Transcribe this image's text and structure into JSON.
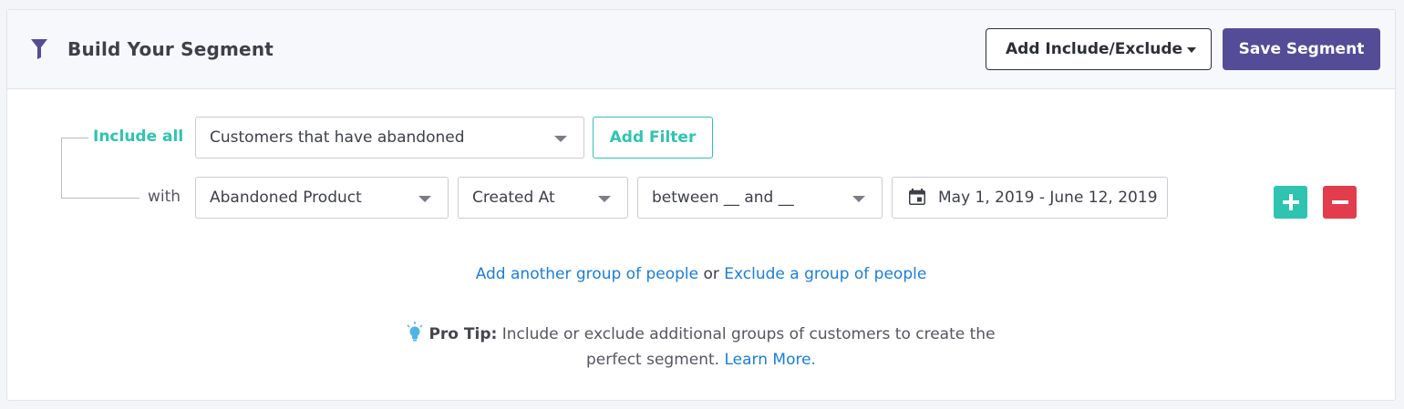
{
  "header": {
    "title": "Build Your Segment",
    "add_include_exclude_label": "Add Include/Exclude",
    "save_segment_label": "Save Segment"
  },
  "group": {
    "include_label": "Include all",
    "audience_select": "Customers that have abandoned",
    "add_filter_label": "Add Filter",
    "with_label": "with",
    "filter": {
      "property_select": "Abandoned Product",
      "field_select": "Created At",
      "operator_select": "between __ and __",
      "date_range": "May 1, 2019 - June 12, 2019"
    }
  },
  "links": {
    "add_group": "Add another group of people",
    "separator": "or",
    "exclude_group": "Exclude a group of people"
  },
  "pro_tip": {
    "label": "Pro Tip:",
    "text_line1": "Include or exclude additional groups of customers to create the",
    "text_line2": "perfect segment.",
    "learn_more": "Learn More."
  },
  "colors": {
    "accent_purple": "#554c98",
    "teal": "#2ec4b0",
    "red": "#e33d4d",
    "link_blue": "#1a7ed9"
  },
  "icons": {
    "filter": "funnel-icon",
    "calendar": "calendar-icon",
    "add": "plus-icon",
    "remove": "minus-icon",
    "tip": "lightbulb-icon"
  }
}
